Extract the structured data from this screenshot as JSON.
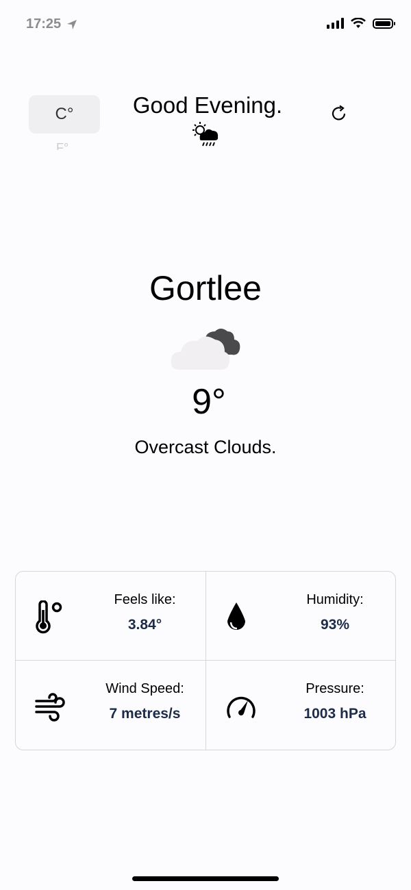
{
  "status_bar": {
    "time": "17:25"
  },
  "header": {
    "unit_active": "C°",
    "unit_alt": "F°",
    "greeting": "Good Evening.",
    "greeting_icon": "sun-rain-cloud-icon",
    "refresh_icon": "refresh-icon"
  },
  "main": {
    "city": "Gortlee",
    "weather_icon": "overcast-clouds-icon",
    "temperature": "9°",
    "description": "Overcast Clouds."
  },
  "stats": [
    {
      "icon": "thermometer-icon",
      "label": "Feels like:",
      "value": "3.84°"
    },
    {
      "icon": "water-drop-icon",
      "label": "Humidity:",
      "value": "93%"
    },
    {
      "icon": "wind-icon",
      "label": "Wind Speed:",
      "value": "7 metres/s"
    },
    {
      "icon": "gauge-icon",
      "label": "Pressure:",
      "value": "1003 hPa"
    }
  ],
  "colors": {
    "value_text": "#1c2b47",
    "background": "#fcfbfd",
    "toggle_bg": "#efeef0"
  }
}
